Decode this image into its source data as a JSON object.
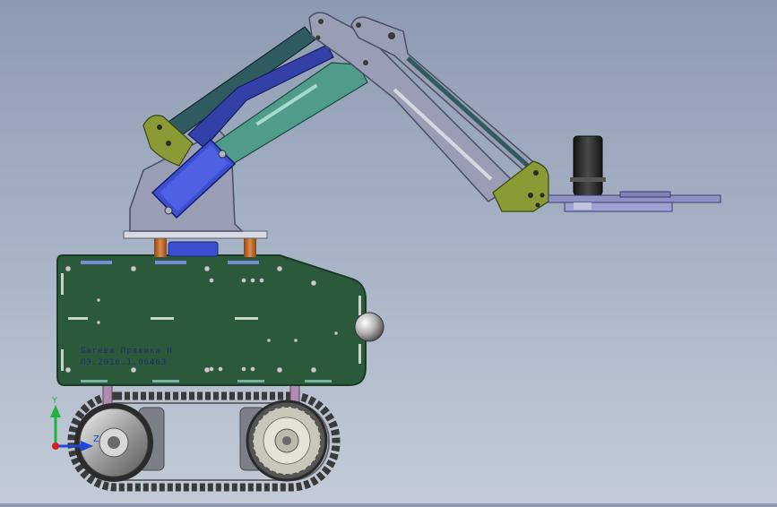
{
  "scene": {
    "pcb_label_line1": "Багеев Правика Н",
    "pcb_label_line2": "ПЭ.2016.1.06463"
  },
  "triad": {
    "y_label": "Y",
    "z_label": "Z",
    "y_color": "#1fb23c",
    "z_color": "#2048d8",
    "origin_color": "#d32020"
  },
  "colors": {
    "background": "#a7b3c6",
    "pcb": "#2b5a3a",
    "arm_grey": "#9a9eb4",
    "arm_teal": "#4f9c8a",
    "arm_dark_teal": "#2e5a60",
    "arm_blue": "#3340a8",
    "arm_olive": "#8a9a34",
    "servo_blue": "#3b4fd0",
    "motor": "#2a2a2a",
    "copper": "#c06a30",
    "track": "#3a3a3a"
  }
}
